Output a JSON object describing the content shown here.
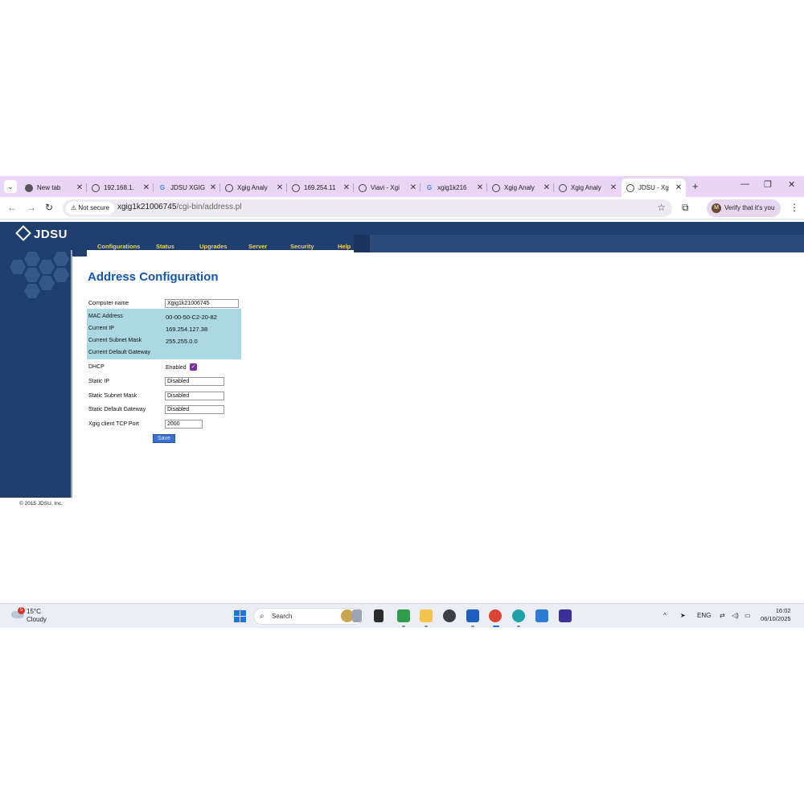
{
  "browser": {
    "tabs": [
      {
        "title": "New tab",
        "icon": "chrome-icon"
      },
      {
        "title": "192.168.1.",
        "icon": "globe-icon"
      },
      {
        "title": "JDSU XGIG",
        "icon": "google-icon"
      },
      {
        "title": "Xgig Analy",
        "icon": "globe-icon"
      },
      {
        "title": "169.254.11",
        "icon": "globe-icon"
      },
      {
        "title": "Viavi - Xgi",
        "icon": "globe-icon"
      },
      {
        "title": "xgig1k216",
        "icon": "google-icon"
      },
      {
        "title": "Xgig Analy",
        "icon": "globe-icon"
      },
      {
        "title": "Xgig Analy",
        "icon": "globe-icon"
      },
      {
        "title": "JDSU - Xg",
        "icon": "globe-icon",
        "active": true
      }
    ],
    "security_label": "Not secure",
    "url_host": "xgig1k21006745",
    "url_path": "/cgi-bin/address.pl",
    "profile_label": "Verify that it's you",
    "profile_initial": "M"
  },
  "site": {
    "logo": "JDSU",
    "menu": [
      "Configurations",
      "Status",
      "Upgrades",
      "Server",
      "Security",
      "Help"
    ],
    "copyright": "© 2015 JDSU, Inc."
  },
  "form": {
    "title": "Address Configuration",
    "computer_name_label": "Computer name",
    "computer_name_value": "Xgig1k21006745",
    "mac_label": "MAC Address",
    "mac_value": "00-00-50-C2-20-82",
    "ip_label": "Current IP",
    "ip_value": "169.254.127.38",
    "mask_label": "Current Subnet Mask",
    "mask_value": "255.255.0.0",
    "gateway_label": "Current Default Gateway",
    "dhcp_label": "DHCP",
    "dhcp_value": "Enabled",
    "dhcp_checked": true,
    "static_ip_label": "Static IP",
    "static_ip_value": "Disabled",
    "static_mask_label": "Static Subnet Mask",
    "static_mask_value": "Disabled",
    "static_gateway_label": "Static Default Gateway",
    "static_gateway_value": "Disabled",
    "tcp_port_label": "Xgig client TCP Port",
    "tcp_port_value": "2000",
    "save_label": "Save"
  },
  "taskbar": {
    "weather_temp": "15°C",
    "weather_desc": "Cloudy",
    "weather_badge": "5",
    "search_label": "Search",
    "language": "ENG",
    "time": "16:02",
    "date": "06/10/2025"
  }
}
